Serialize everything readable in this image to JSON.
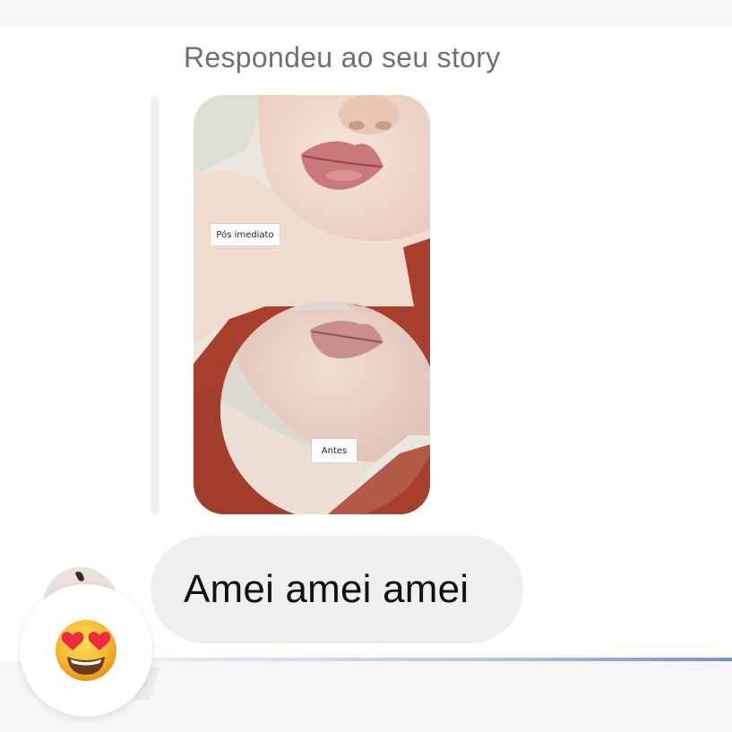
{
  "header": {
    "replied_text": "Respondeu ao seu story"
  },
  "story": {
    "label_after": "Pós imediato",
    "label_before": "Antes"
  },
  "message": {
    "text": "Amei amei amei"
  },
  "reaction": {
    "icon": "heart-eyes-emoji-icon"
  },
  "colors": {
    "bubble_bg": "#efeff2",
    "secondary_text": "#6f6f78",
    "progress_accent": "#6f93cf",
    "story_backdrop": "#a9402e"
  }
}
